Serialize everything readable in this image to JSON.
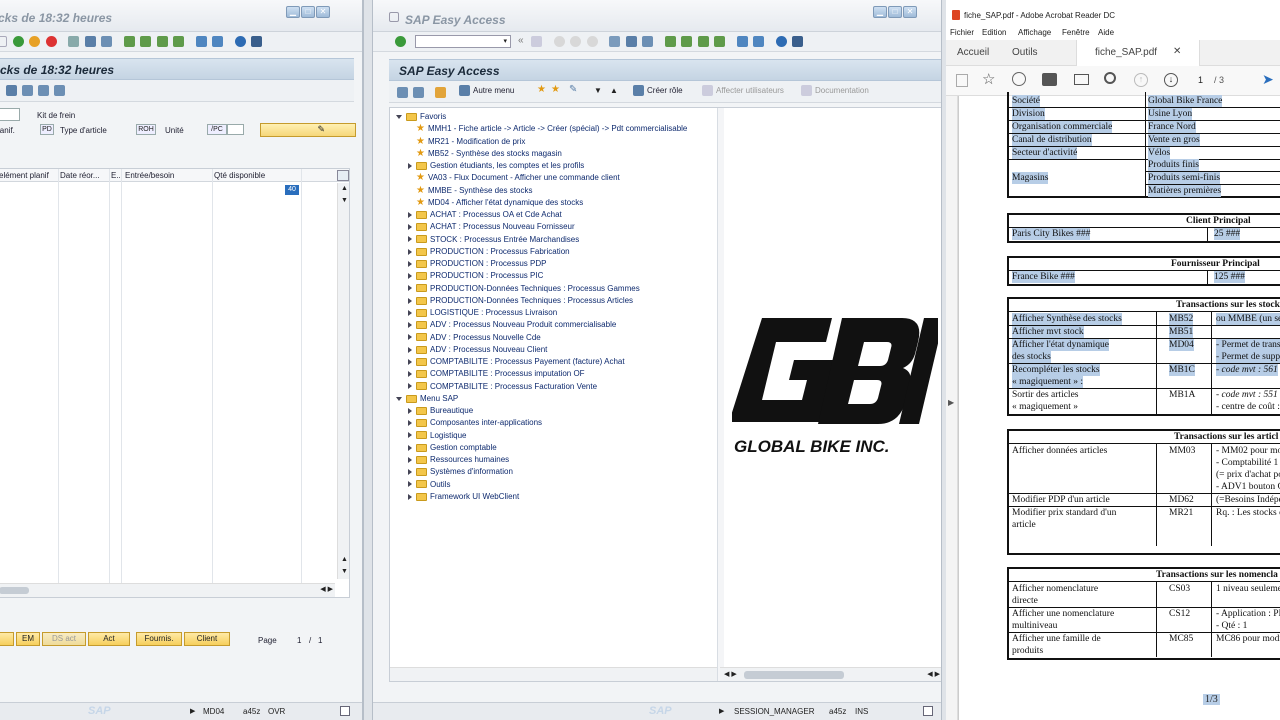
{
  "w1": {
    "title": "cks de 18:32 heures",
    "header": "cks de 18:32 heures",
    "field_kit": "Kit de frein",
    "label_planif": "lanif.",
    "planif_value": "PD",
    "label_type_article": "Type d'article",
    "type_article_value": "ROH",
    "label_unite": "Unité",
    "unite_value": "/PC",
    "columns": [
      "elément planif",
      "Date réor...",
      "E..",
      "Entrée/besoin",
      "Qté disponible"
    ],
    "qte_value": "40",
    "footer_buttons": [
      "EM",
      "DS act",
      "Act",
      "Fournis.",
      "Client"
    ],
    "page_label": "Page",
    "page_value": "1",
    "page_sep": "/",
    "page_total": "1",
    "status": {
      "tcode": "MD04",
      "server": "a45z",
      "mode": "OVR"
    },
    "logo": "SAP"
  },
  "w2": {
    "title": "SAP Easy Access",
    "header": "SAP Easy Access",
    "toolbar": {
      "autre_menu": "Autre menu",
      "creer_role": "Créer rôle",
      "affecter": "Affecter utilisateurs",
      "documentation": "Documentation"
    },
    "favoris_label": "Favoris",
    "favorites": [
      "MMH1 - Fiche article -> Article -> Créer (spécial) -> Pdt commercialisable",
      "MR21 - Modification de prix",
      "MB52 - Synthèse des stocks magasin",
      "Gestion étudiants, les comptes et les profils",
      "VA03 - Flux Document - Afficher une commande client",
      "MMBE - Synthèse des stocks",
      "MD04 - Afficher l'état dynamique des stocks",
      "ACHAT : Processus OA et Cde Achat",
      "ACHAT : Processus Nouveau Fornisseur",
      "STOCK : Processus Entrée Marchandises",
      "PRODUCTION : Processus Fabrication",
      "PRODUCTION : Processus PDP",
      "PRODUCTION : Processus PIC",
      "PRODUCTION-Données Techniques : Processus Gammes",
      "PRODUCTION-Données Techniques : Processus Articles",
      "LOGISTIQUE : Processus Livraison",
      "ADV : Processus Nouveau Produit commercialisable",
      "ADV : Processus Nouvelle Cde",
      "ADV : Processus  Nouveau Client",
      "COMPTABILITE : Processus Payement (facture) Achat",
      "COMPTABILITE : Processus imputation OF",
      "COMPTABILITE : Processus Facturation Vente"
    ],
    "menu_label": "Menu SAP",
    "menu_items": [
      "Bureautique",
      "Composantes inter-applications",
      "Logistique",
      "Gestion comptable",
      "Ressources humaines",
      "Systèmes d'information",
      "Outils",
      "Framework UI WebClient"
    ],
    "logo_text": "GLOBAL BIKE INC.",
    "logo_letters": "GBI",
    "status": {
      "session": "SESSION_MANAGER",
      "server": "a45z",
      "mode": "INS"
    },
    "sap_logo": "SAP"
  },
  "w3": {
    "title": "fiche_SAP.pdf - Adobe Acrobat Reader DC",
    "menu": [
      "Fichier",
      "Edition",
      "Affichage",
      "Fenêtre",
      "Aide"
    ],
    "tabs": [
      "Accueil",
      "Outils",
      "fiche_SAP.pdf"
    ],
    "page_current": "1",
    "page_total": "/ 3",
    "page_indicator": "1/3",
    "org": [
      [
        "Société",
        "Global Bike France"
      ],
      [
        "Division",
        "Usine Lyon"
      ],
      [
        "Organisation commerciale",
        "France Nord"
      ],
      [
        "Canal de distribution",
        "Vente en gros"
      ],
      [
        "Secteur d'activité",
        "Vélos"
      ]
    ],
    "magasins_label": "Magasins",
    "magasins": [
      "Produits finis",
      "Produits semi-finis",
      "Matières premières"
    ],
    "client_header": "Client Principal",
    "client_row": [
      "Paris City Bikes ###",
      "25 ###"
    ],
    "fournisseur_header": "Fournisseur Principal",
    "fournisseur_row": [
      "France Bike ###",
      "125 ###"
    ],
    "stock_header": "Transactions sur les stock",
    "stock_rows": [
      {
        "a": "Afficher Synthèse des stocks",
        "b": "MB52",
        "c": "ou MMBE (un se"
      },
      {
        "a": "Afficher mvt stock",
        "b": "MB51",
        "c": ""
      },
      {
        "a": "Afficher l'état dynamique",
        "a2": "des stocks",
        "b": "MD04",
        "c": "- Permet de trans",
        "c2": "- Permet de suppr"
      },
      {
        "a": "Recompléter les stocks",
        "a2": "« magiquement » :",
        "b": "MB1C",
        "c": "- code mvt : 561"
      },
      {
        "a": "Sortir des articles",
        "a2": "« magiquement »",
        "b": "MB1A",
        "c": "- code mvt : 551",
        "c2": "- centre de coût :"
      }
    ],
    "articles_header": "Transactions sur les articl",
    "articles_rows": [
      {
        "a": "Afficher données articles",
        "b": "MM03",
        "c": "- MM02 pour mo",
        "c2": "- Comptabilité 1 p",
        "c3": "(= prix d'achat po",
        "c4": "- ADV1 bouton C"
      },
      {
        "a": "Modifier PDP d'un article",
        "b": "MD62",
        "c": "(=Besoins Indépe"
      },
      {
        "a": "Modifier prix standard d'un",
        "a2": "article",
        "b": "MR21",
        "c": "Rq. : Les stocks d"
      }
    ],
    "nomen_header": "Transactions sur les nomencla",
    "nomen_rows": [
      {
        "a": "Afficher nomenclature",
        "a2": "directe",
        "b": "CS03",
        "c": "1 niveau seulemen"
      },
      {
        "a": "Afficher une nomenclature",
        "a2": "multiniveau",
        "b": "CS12",
        "c": "- Application : PP",
        "c2": "- Qté : 1"
      },
      {
        "a": "Afficher une famille de",
        "a2": "produits",
        "b": "MC85",
        "c": "MC86 pour modi"
      }
    ]
  }
}
